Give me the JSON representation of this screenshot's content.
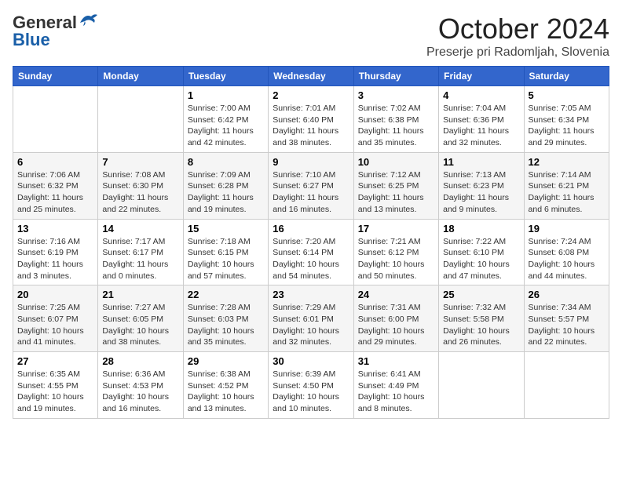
{
  "header": {
    "logo_general": "General",
    "logo_blue": "Blue",
    "month_title": "October 2024",
    "location": "Preserje pri Radomljah, Slovenia"
  },
  "weekdays": [
    "Sunday",
    "Monday",
    "Tuesday",
    "Wednesday",
    "Thursday",
    "Friday",
    "Saturday"
  ],
  "weeks": [
    [
      {
        "day": "",
        "info": ""
      },
      {
        "day": "",
        "info": ""
      },
      {
        "day": "1",
        "info": "Sunrise: 7:00 AM\nSunset: 6:42 PM\nDaylight: 11 hours and 42 minutes."
      },
      {
        "day": "2",
        "info": "Sunrise: 7:01 AM\nSunset: 6:40 PM\nDaylight: 11 hours and 38 minutes."
      },
      {
        "day": "3",
        "info": "Sunrise: 7:02 AM\nSunset: 6:38 PM\nDaylight: 11 hours and 35 minutes."
      },
      {
        "day": "4",
        "info": "Sunrise: 7:04 AM\nSunset: 6:36 PM\nDaylight: 11 hours and 32 minutes."
      },
      {
        "day": "5",
        "info": "Sunrise: 7:05 AM\nSunset: 6:34 PM\nDaylight: 11 hours and 29 minutes."
      }
    ],
    [
      {
        "day": "6",
        "info": "Sunrise: 7:06 AM\nSunset: 6:32 PM\nDaylight: 11 hours and 25 minutes."
      },
      {
        "day": "7",
        "info": "Sunrise: 7:08 AM\nSunset: 6:30 PM\nDaylight: 11 hours and 22 minutes."
      },
      {
        "day": "8",
        "info": "Sunrise: 7:09 AM\nSunset: 6:28 PM\nDaylight: 11 hours and 19 minutes."
      },
      {
        "day": "9",
        "info": "Sunrise: 7:10 AM\nSunset: 6:27 PM\nDaylight: 11 hours and 16 minutes."
      },
      {
        "day": "10",
        "info": "Sunrise: 7:12 AM\nSunset: 6:25 PM\nDaylight: 11 hours and 13 minutes."
      },
      {
        "day": "11",
        "info": "Sunrise: 7:13 AM\nSunset: 6:23 PM\nDaylight: 11 hours and 9 minutes."
      },
      {
        "day": "12",
        "info": "Sunrise: 7:14 AM\nSunset: 6:21 PM\nDaylight: 11 hours and 6 minutes."
      }
    ],
    [
      {
        "day": "13",
        "info": "Sunrise: 7:16 AM\nSunset: 6:19 PM\nDaylight: 11 hours and 3 minutes."
      },
      {
        "day": "14",
        "info": "Sunrise: 7:17 AM\nSunset: 6:17 PM\nDaylight: 11 hours and 0 minutes."
      },
      {
        "day": "15",
        "info": "Sunrise: 7:18 AM\nSunset: 6:15 PM\nDaylight: 10 hours and 57 minutes."
      },
      {
        "day": "16",
        "info": "Sunrise: 7:20 AM\nSunset: 6:14 PM\nDaylight: 10 hours and 54 minutes."
      },
      {
        "day": "17",
        "info": "Sunrise: 7:21 AM\nSunset: 6:12 PM\nDaylight: 10 hours and 50 minutes."
      },
      {
        "day": "18",
        "info": "Sunrise: 7:22 AM\nSunset: 6:10 PM\nDaylight: 10 hours and 47 minutes."
      },
      {
        "day": "19",
        "info": "Sunrise: 7:24 AM\nSunset: 6:08 PM\nDaylight: 10 hours and 44 minutes."
      }
    ],
    [
      {
        "day": "20",
        "info": "Sunrise: 7:25 AM\nSunset: 6:07 PM\nDaylight: 10 hours and 41 minutes."
      },
      {
        "day": "21",
        "info": "Sunrise: 7:27 AM\nSunset: 6:05 PM\nDaylight: 10 hours and 38 minutes."
      },
      {
        "day": "22",
        "info": "Sunrise: 7:28 AM\nSunset: 6:03 PM\nDaylight: 10 hours and 35 minutes."
      },
      {
        "day": "23",
        "info": "Sunrise: 7:29 AM\nSunset: 6:01 PM\nDaylight: 10 hours and 32 minutes."
      },
      {
        "day": "24",
        "info": "Sunrise: 7:31 AM\nSunset: 6:00 PM\nDaylight: 10 hours and 29 minutes."
      },
      {
        "day": "25",
        "info": "Sunrise: 7:32 AM\nSunset: 5:58 PM\nDaylight: 10 hours and 26 minutes."
      },
      {
        "day": "26",
        "info": "Sunrise: 7:34 AM\nSunset: 5:57 PM\nDaylight: 10 hours and 22 minutes."
      }
    ],
    [
      {
        "day": "27",
        "info": "Sunrise: 6:35 AM\nSunset: 4:55 PM\nDaylight: 10 hours and 19 minutes."
      },
      {
        "day": "28",
        "info": "Sunrise: 6:36 AM\nSunset: 4:53 PM\nDaylight: 10 hours and 16 minutes."
      },
      {
        "day": "29",
        "info": "Sunrise: 6:38 AM\nSunset: 4:52 PM\nDaylight: 10 hours and 13 minutes."
      },
      {
        "day": "30",
        "info": "Sunrise: 6:39 AM\nSunset: 4:50 PM\nDaylight: 10 hours and 10 minutes."
      },
      {
        "day": "31",
        "info": "Sunrise: 6:41 AM\nSunset: 4:49 PM\nDaylight: 10 hours and 8 minutes."
      },
      {
        "day": "",
        "info": ""
      },
      {
        "day": "",
        "info": ""
      }
    ]
  ]
}
